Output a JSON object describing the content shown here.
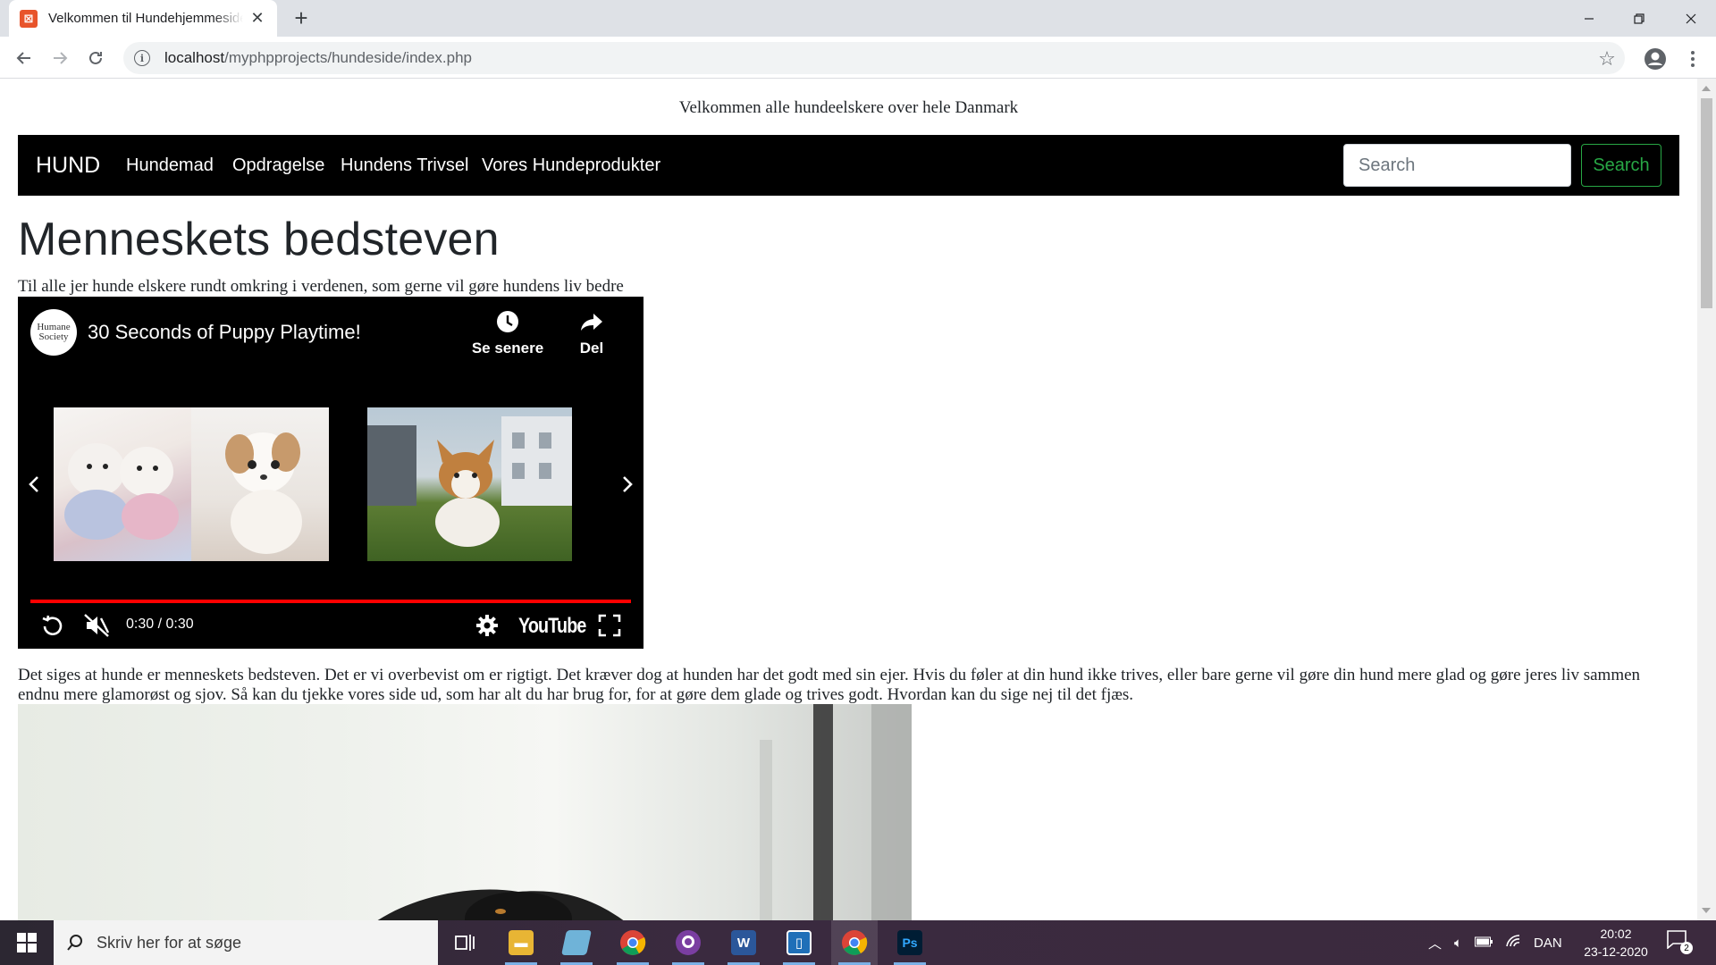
{
  "browser": {
    "tab_title": "Velkommen til Hundehjemmeside",
    "url_host": "localhost",
    "url_path": "/myphpprojects/hundeside/index.php"
  },
  "page": {
    "welcome": "Velkommen alle hundeelskere over hele Danmark",
    "brand": "HUND",
    "nav": [
      "Hundemad",
      "Opdragelse",
      "Hundens Trivsel",
      "Vores Hundeprodukter"
    ],
    "search": {
      "placeholder": "Search",
      "button": "Search"
    },
    "headline": "Menneskets bedsteven",
    "subtitle": "Til alle jer hunde elskere rundt omkring i verdenen, som gerne vil gøre hundens liv bedre",
    "video": {
      "channel_avatar": "Humane Society",
      "title": "30 Seconds of Puppy Playtime!",
      "watch_later": "Se senere",
      "share": "Del",
      "time": "0:30 / 0:30",
      "progress": 1.0,
      "logo": "YouTube"
    },
    "body": "Det siges at hunde er menneskets bedsteven. Det er vi overbevist om er rigtigt. Det kræver dog at hunden har det godt med sin ejer. Hvis du føler at din hund ikke trives, eller bare gerne vil gøre din hund mere glad og gøre jeres liv sammen endnu mere glamorøst og sjov. Så kan du tjekke vores side ud, som har alt du har brug for, for at gøre dem glade og trives godt. Hvordan kan du sige nej til det fjæs."
  },
  "taskbar": {
    "search_placeholder": "Skriv her for at søge",
    "language": "DAN",
    "time": "20:02",
    "date": "23-12-2020",
    "notifications": "2",
    "apps": [
      "task-view",
      "file-explorer",
      "notepad",
      "chrome",
      "github-desktop",
      "word",
      "app",
      "chrome",
      "photoshop"
    ]
  },
  "colors": {
    "nav_bg": "#000000",
    "search_accent": "#28a745",
    "progress": "#ff0000",
    "tab_favicon": "#e8542b"
  }
}
